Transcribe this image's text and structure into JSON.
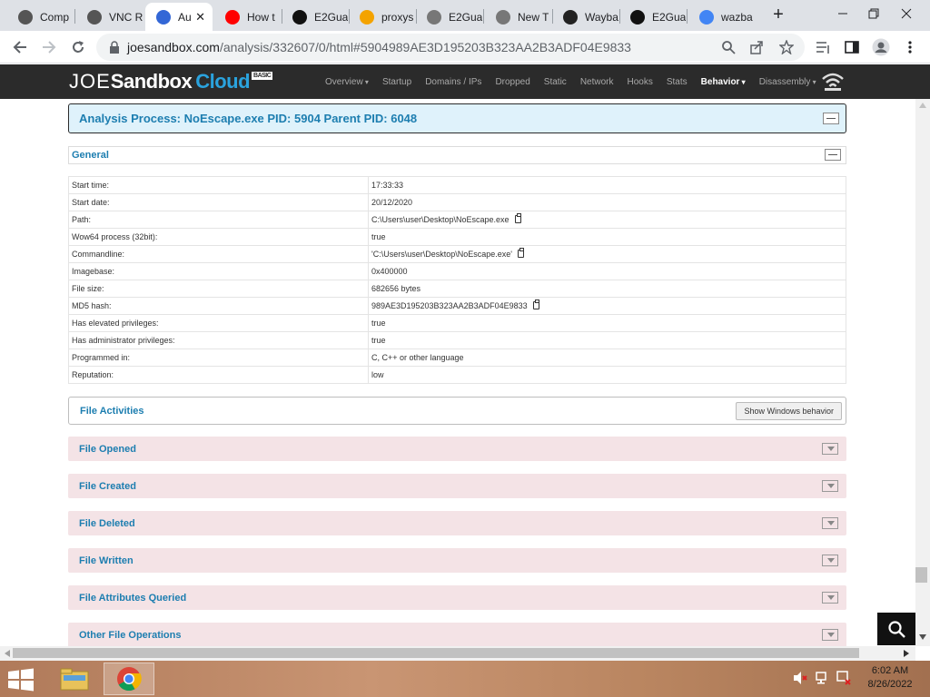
{
  "browser": {
    "tabs": [
      {
        "label": "Comp",
        "icon": "virus-icon",
        "color": "#555555"
      },
      {
        "label": "VNC R",
        "icon": "virus-icon",
        "color": "#555555"
      },
      {
        "label": "Au",
        "icon": "chrome-loading-icon",
        "color": "#3367d6",
        "active": true
      },
      {
        "label": "How t",
        "icon": "youtube-icon",
        "color": "#ff0000"
      },
      {
        "label": "E2Gua",
        "icon": "github-icon",
        "color": "#111111"
      },
      {
        "label": "proxys",
        "icon": "proxy-icon",
        "color": "#f4a300"
      },
      {
        "label": "E2Gua",
        "icon": "chrome-icon",
        "color": "#777777"
      },
      {
        "label": "New T",
        "icon": "chrome-icon",
        "color": "#777777"
      },
      {
        "label": "Wayba",
        "icon": "archive-icon",
        "color": "#222222"
      },
      {
        "label": "E2Gua",
        "icon": "github-icon",
        "color": "#111111"
      },
      {
        "label": "wazba",
        "icon": "google-icon",
        "color": "#4285f4"
      }
    ],
    "url_host": "joesandbox.com",
    "url_path": "/analysis/332607/0/html#5904989AE3D195203B323AA2B3ADF04E9833"
  },
  "site": {
    "brand_joe": "JOE",
    "brand_sandbox": "Sandbox",
    "brand_cloud": "Cloud",
    "brand_badge": "BASIC",
    "nav": [
      {
        "label": "Overview",
        "dropdown": true
      },
      {
        "label": "Startup"
      },
      {
        "label": "Domains / IPs"
      },
      {
        "label": "Dropped"
      },
      {
        "label": "Static"
      },
      {
        "label": "Network"
      },
      {
        "label": "Hooks"
      },
      {
        "label": "Stats"
      },
      {
        "label": "Behavior",
        "dropdown": true,
        "active": true
      },
      {
        "label": "Disassembly",
        "dropdown": true
      }
    ]
  },
  "process": {
    "title": "Analysis Process: NoEscape.exe PID: 5904 Parent PID: 6048"
  },
  "general": {
    "title": "General",
    "rows": [
      {
        "key": "Start time:",
        "value": "17:33:33"
      },
      {
        "key": "Start date:",
        "value": "20/12/2020"
      },
      {
        "key": "Path:",
        "value": "C:\\Users\\user\\Desktop\\NoEscape.exe",
        "copy": true
      },
      {
        "key": "Wow64 process (32bit):",
        "value": "true"
      },
      {
        "key": "Commandline:",
        "value": "'C:\\Users\\user\\Desktop\\NoEscape.exe'",
        "copy": true
      },
      {
        "key": "Imagebase:",
        "value": "0x400000"
      },
      {
        "key": "File size:",
        "value": "682656 bytes"
      },
      {
        "key": "MD5 hash:",
        "value": "989AE3D195203B323AA2B3ADF04E9833",
        "copy": true
      },
      {
        "key": "Has elevated privileges:",
        "value": "true"
      },
      {
        "key": "Has administrator privileges:",
        "value": "true"
      },
      {
        "key": "Programmed in:",
        "value": "C, C++ or other language"
      },
      {
        "key": "Reputation:",
        "value": "low"
      }
    ]
  },
  "file_activities": {
    "title": "File Activities",
    "button": "Show Windows behavior",
    "sections": [
      "File Opened",
      "File Created",
      "File Deleted",
      "File Written",
      "File Attributes Queried",
      "Other File Operations"
    ]
  },
  "taskbar": {
    "time": "6:02 AM",
    "date": "8/26/2022"
  }
}
